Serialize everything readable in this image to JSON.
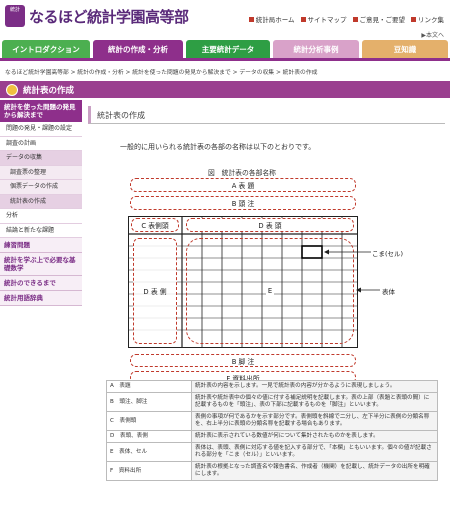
{
  "header": {
    "logo_badge": "統計",
    "site_title": "なるほど統計学園高等部",
    "top_links": [
      "統計局ホーム",
      "サイトマップ",
      "ご意見・ご要望",
      "リンク集"
    ],
    "english_link": "▶本文へ"
  },
  "nav": {
    "tabs": [
      "イントロダクション",
      "統計の作成・分析",
      "主要統計データ",
      "統計分析事例",
      "豆知識"
    ]
  },
  "breadcrumb": "なるほど統計学園高等部 > 統計の作成・分析 > 統計を使った問題の発見から解決まで > データの収集 > 統計表の作成",
  "page_title": "統計表の作成",
  "sidebar": {
    "head": "統計を使った問題の発見から解決まで",
    "items": [
      {
        "label": "問題の発見・課題の設定",
        "level": "item"
      },
      {
        "label": "調査の計画",
        "level": "item"
      },
      {
        "label": "データの収集",
        "level": "item",
        "active": true
      },
      {
        "label": "調査票の整理",
        "level": "sub"
      },
      {
        "label": "個票データの作成",
        "level": "sub"
      },
      {
        "label": "統計表の作成",
        "level": "sub",
        "active": true
      },
      {
        "label": "分析",
        "level": "item"
      },
      {
        "label": "結論と新たな課題",
        "level": "item"
      }
    ],
    "blocks": [
      "練習問題",
      "統計を学ぶ上で必要な基礎数学",
      "統計のできるまで",
      "統計用語辞典"
    ]
  },
  "content": {
    "heading": "統計表の作成",
    "intro": "一般的に用いられる統計表の各部の名称は以下のとおりです。",
    "figure_title": "図　統計表の各部名称",
    "diagram": {
      "a": "A 表 題",
      "b_top": "B 頭 注",
      "c": "C 表側頭",
      "d_head": "D 表 頭",
      "d_side": "D 表 側",
      "e": "E",
      "b_bottom": "B 脚 注",
      "f": "F 資料出所",
      "cell_callout": "こま(セル)",
      "body_callout": "表体"
    },
    "legend": [
      {
        "key": "A　表題",
        "desc": "統計表の内容を示します。一見で統計表の内容が分かるように表現しましょう。"
      },
      {
        "key": "B　頭注、脚注",
        "desc": "統計表や統計表中の個々の値に付する補足説明を記載します。表の上部（表題と表頭の間）に記載するものを「頭注」、表の下部に記載するものを「脚注」といいます。"
      },
      {
        "key": "C　表側頭",
        "desc": "表側の事項が何であるかを示す部分です。表側頭を斜線で二分し、左下半分に表側の分類名称を、右上半分に表頭の分類名称を記載する場合もあります。"
      },
      {
        "key": "D　表頭、表側",
        "desc": "統計表に表示されている数値が何について集計されたものかを表します。"
      },
      {
        "key": "E　表体、セル",
        "desc": "表体は、表頭、表側に対応する値を記入する部分で、「本欄」ともいいます。個々の値が記載される部分を「こま（セル）」といいます。"
      },
      {
        "key": "F　資料出所",
        "desc": "統計表の根拠となった調査名や報告書名、作成者（機関）を記載し、統計データの出所を明確にします。"
      }
    ]
  },
  "colors": {
    "brand_purple": "#8e2f8b",
    "dashed_red": "#c0392b",
    "tab_green": "#4caf50"
  }
}
